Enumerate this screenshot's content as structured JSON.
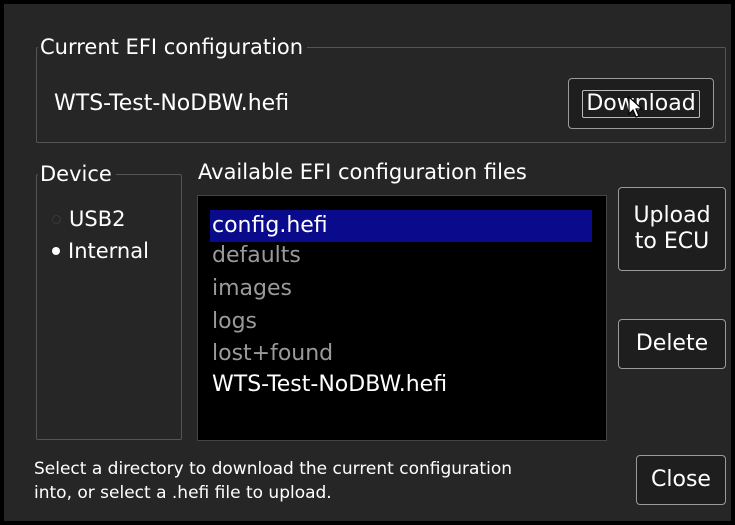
{
  "current_config": {
    "title": "Current EFI configuration",
    "filename": "WTS-Test-NoDBW.hefi",
    "download_label": "Download"
  },
  "device": {
    "title": "Device",
    "options": [
      {
        "label": "USB2",
        "selected": false,
        "enabled": false
      },
      {
        "label": "Internal",
        "selected": true,
        "enabled": true
      }
    ]
  },
  "files": {
    "title": "Available EFI configuration files",
    "items": [
      {
        "label": "config.hefi",
        "type": "file",
        "selected": true
      },
      {
        "label": "defaults",
        "type": "directory",
        "selected": false
      },
      {
        "label": "images",
        "type": "directory",
        "selected": false
      },
      {
        "label": "logs",
        "type": "directory",
        "selected": false
      },
      {
        "label": "lost+found",
        "type": "directory",
        "selected": false
      },
      {
        "label": "WTS-Test-NoDBW.hefi",
        "type": "file",
        "selected": false
      }
    ]
  },
  "actions": {
    "upload_line1": "Upload",
    "upload_line2": "to ECU",
    "delete_label": "Delete",
    "close_label": "Close"
  },
  "status": {
    "line1": "Select a directory to download the current configuration",
    "line2": "into, or select a .hefi file to upload."
  },
  "colors": {
    "selection": "#0a0a8c",
    "directory_text": "#9a9a9a",
    "file_text": "#ffffff"
  }
}
